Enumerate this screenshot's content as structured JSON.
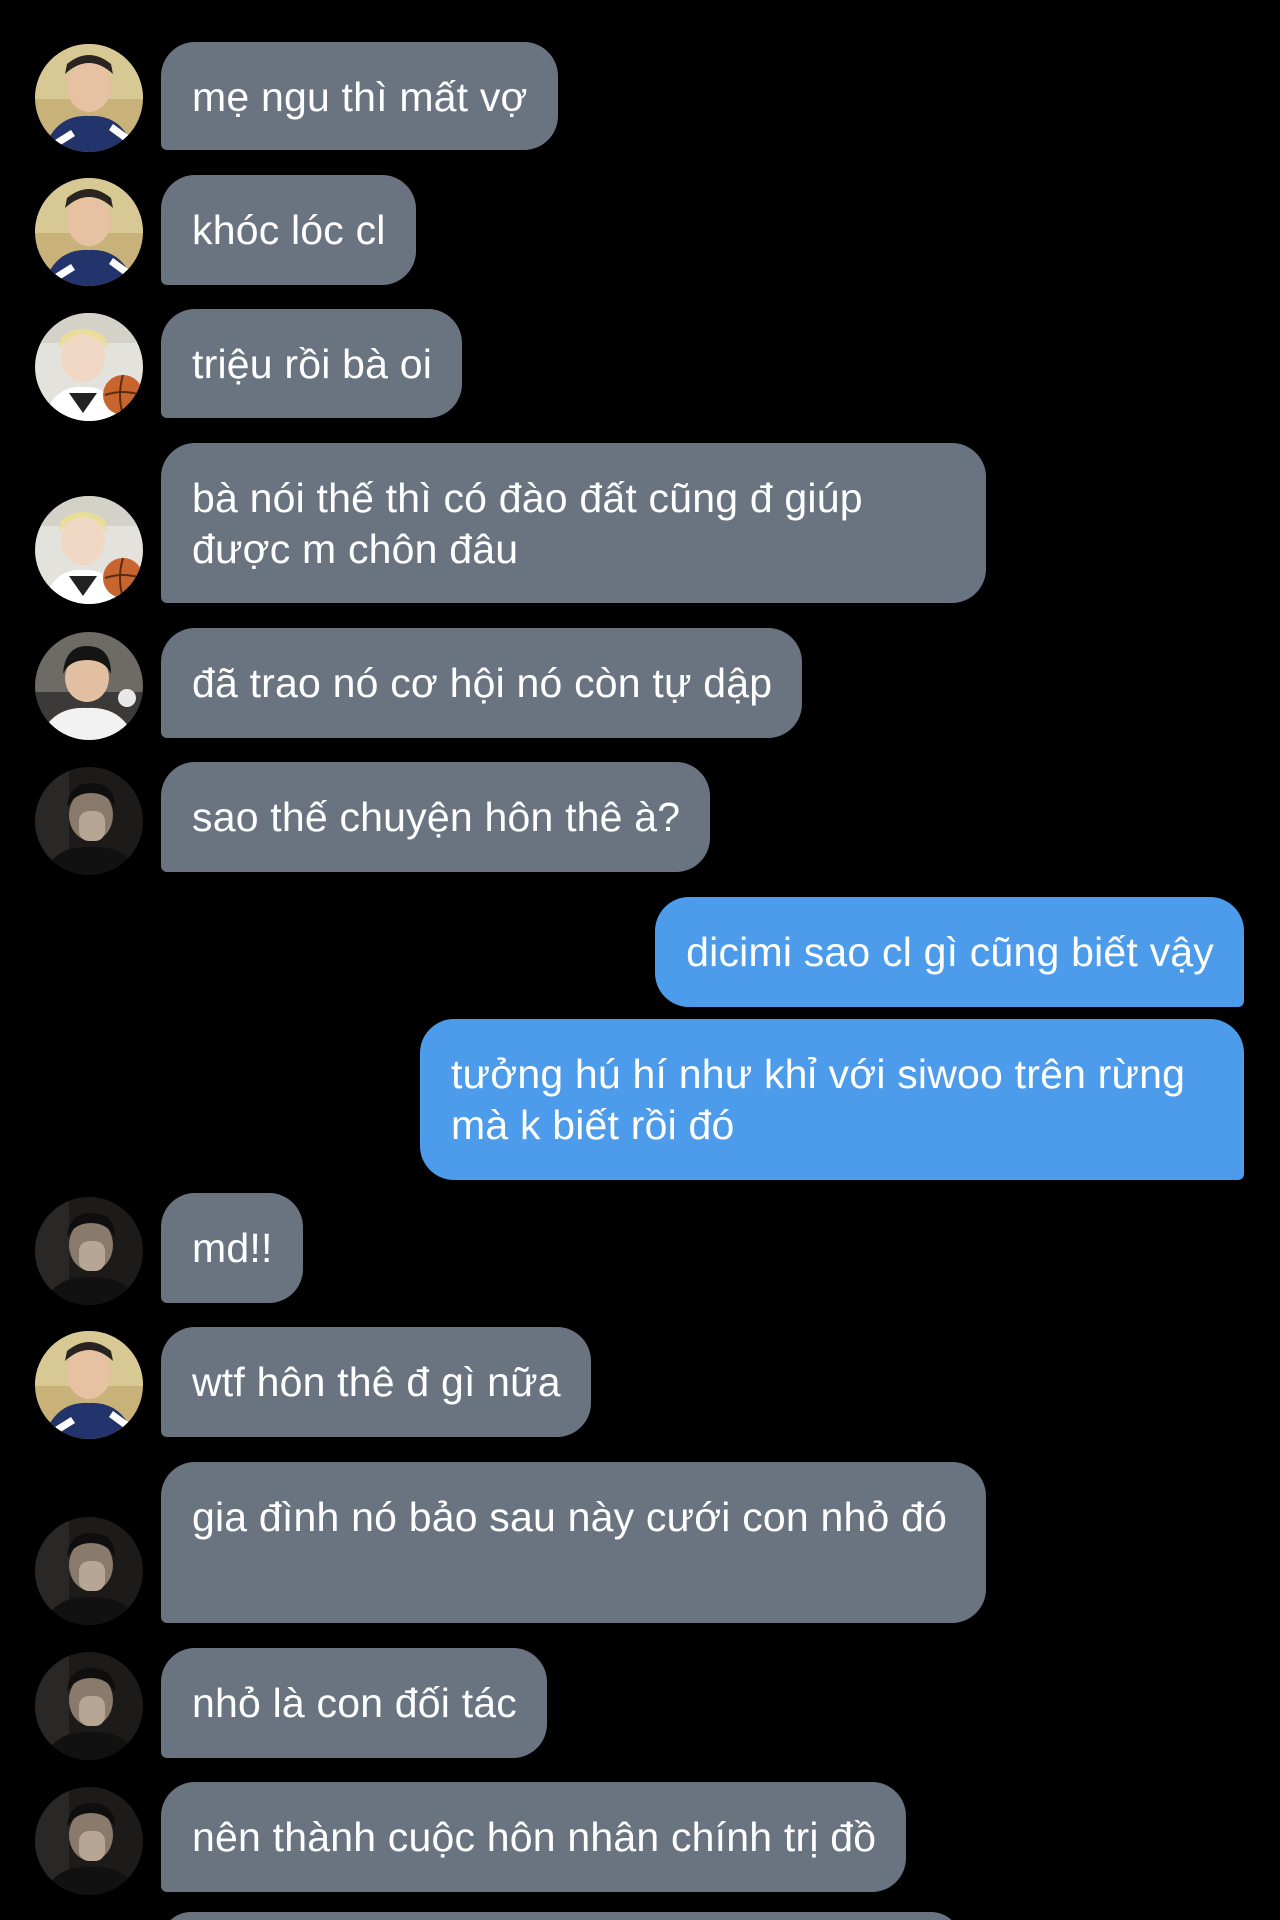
{
  "messages": [
    {
      "direction": "incoming",
      "sender": "user-a",
      "text": "mẹ ngu thì mất vợ"
    },
    {
      "direction": "incoming",
      "sender": "user-a",
      "text": "khóc lóc cl"
    },
    {
      "direction": "incoming",
      "sender": "user-b",
      "text": "triệu rồi bà oi"
    },
    {
      "direction": "incoming",
      "sender": "user-b",
      "text": "bà nói thế thì có đào đất cũng đ giúp được m chôn đâu"
    },
    {
      "direction": "incoming",
      "sender": "user-c",
      "text": "đã trao nó cơ hội nó còn tự dập"
    },
    {
      "direction": "incoming",
      "sender": "user-d",
      "text": "sao thế chuyện hôn thê à?"
    },
    {
      "direction": "outgoing",
      "sender": "me",
      "text": "dicimi sao cl gì cũng biết vậy"
    },
    {
      "direction": "outgoing",
      "sender": "me",
      "text": "tưởng hú hí như khỉ với siwoo trên rừng mà k biết rồi đó"
    },
    {
      "direction": "incoming",
      "sender": "user-d",
      "text": "md!!"
    },
    {
      "direction": "incoming",
      "sender": "user-a",
      "text": "wtf hôn thê đ gì nữa"
    },
    {
      "direction": "incoming",
      "sender": "user-d",
      "text": "gia đình nó bảo sau này cưới con nhỏ đó"
    },
    {
      "direction": "incoming",
      "sender": "user-d",
      "text": "nhỏ là con đối tác"
    },
    {
      "direction": "incoming",
      "sender": "user-d",
      "text": "nên thành cuộc hôn nhân chính trị đồ"
    }
  ],
  "colors": {
    "background": "#000000",
    "incoming_bubble": "#6a7481",
    "outgoing_bubble": "#4c9ceb",
    "text": "#ffffff"
  }
}
